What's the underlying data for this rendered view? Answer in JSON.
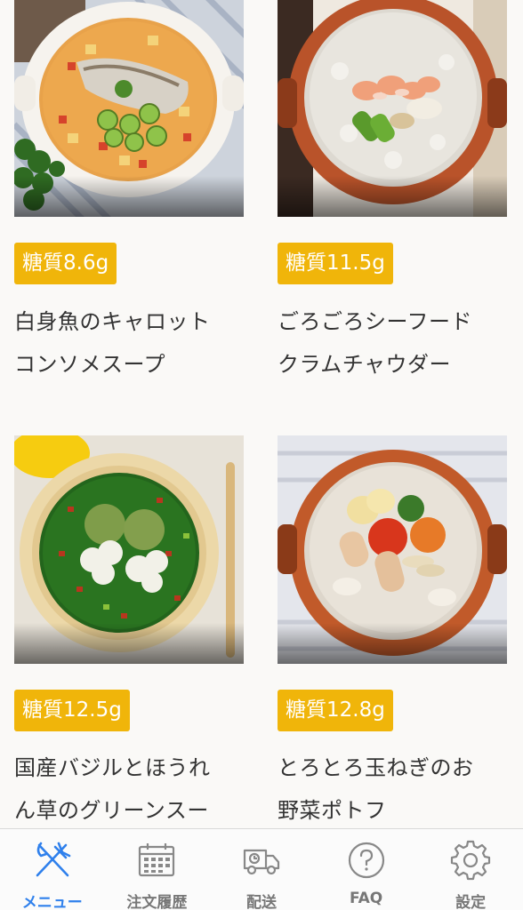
{
  "products": [
    {
      "badge": "糖質8.6g",
      "name_line1": "白身魚のキャロット",
      "name_line2": "コンソメスープ"
    },
    {
      "badge": "糖質11.5g",
      "name_line1": "ごろごろシーフード",
      "name_line2": "クラムチャウダー"
    },
    {
      "badge": "糖質12.5g",
      "name_line1": "国産バジルとほうれ",
      "name_line2": "ん草のグリーンスー"
    },
    {
      "badge": "糖質12.8g",
      "name_line1": "とろとろ玉ねぎのお",
      "name_line2": "野菜ポトフ"
    }
  ],
  "tabbar": {
    "items": [
      {
        "label": "メニュー",
        "icon": "fork-knife-icon",
        "active": true
      },
      {
        "label": "注文履歴",
        "icon": "calendar-icon",
        "active": false
      },
      {
        "label": "配送",
        "icon": "delivery-truck-icon",
        "active": false
      },
      {
        "label": "FAQ",
        "icon": "question-icon",
        "active": false
      },
      {
        "label": "設定",
        "icon": "gear-icon",
        "active": false
      }
    ]
  },
  "colors": {
    "badge": "#f0b50a",
    "active_tab": "#2f80ec",
    "inactive_tab": "#888888"
  }
}
